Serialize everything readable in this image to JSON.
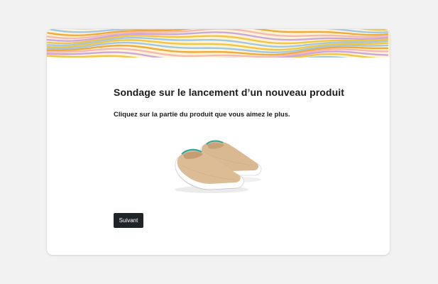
{
  "survey": {
    "title": "Sondage sur le lancement d’un nouveau produit",
    "question": "Cliquez sur la partie du produit que vous aimez le plus.",
    "product_image": "slip-on-shoes-image",
    "next_label": "Suivant"
  },
  "banner": {
    "pattern": "wavy-stripes",
    "colors": [
      "#f4c542",
      "#f2a93b",
      "#9ec7e8",
      "#f6b8b1",
      "#c9a8e0",
      "#fff4d6"
    ]
  },
  "colors": {
    "background": "#f2f2f3",
    "card": "#ffffff",
    "text": "#1b1b1b",
    "button": "#1f2426",
    "button_text": "#ffffff"
  }
}
